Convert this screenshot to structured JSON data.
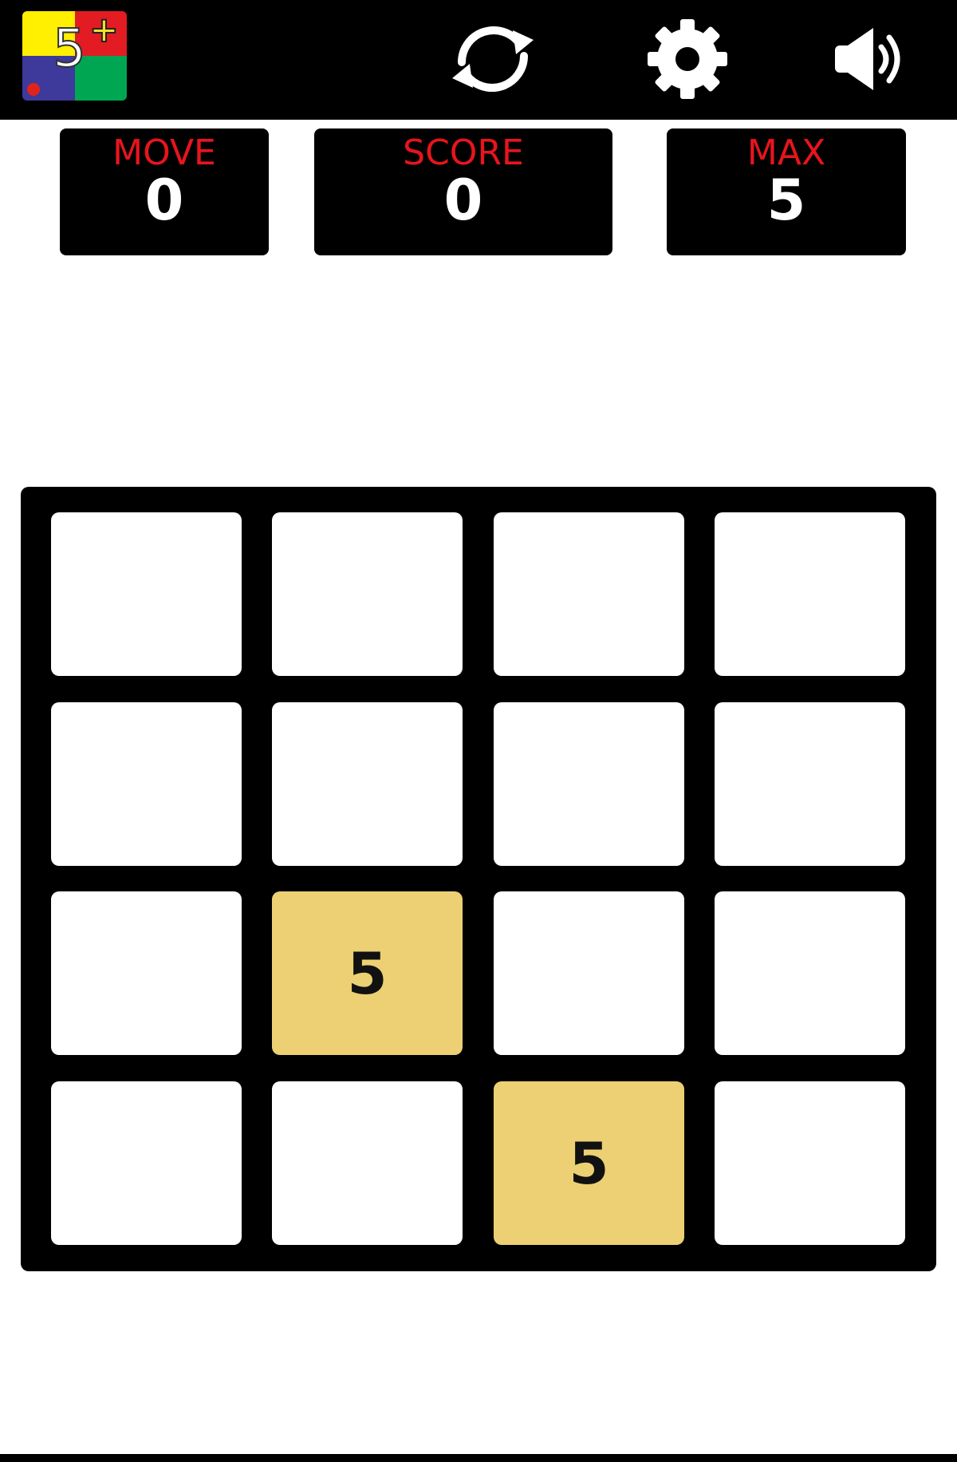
{
  "header": {
    "logo": {
      "digit": "5",
      "plus": "+",
      "colors": [
        "#ffef00",
        "#e21c22",
        "#3d3a9b",
        "#00a652"
      ]
    },
    "buttons": [
      {
        "name": "restart-icon"
      },
      {
        "name": "gear-icon"
      },
      {
        "name": "speaker-icon"
      }
    ]
  },
  "stats": {
    "move": {
      "label": "MOVE",
      "value": "0"
    },
    "score": {
      "label": "SCORE",
      "value": "0"
    },
    "max": {
      "label": "MAX",
      "value": "5"
    }
  },
  "board": {
    "rows": 4,
    "cols": 4,
    "cells": [
      "",
      "",
      "",
      "",
      "",
      "",
      "",
      "",
      "",
      "5",
      "",
      "",
      "",
      "",
      "5",
      ""
    ],
    "empty_color": "#ffffff",
    "tile_color": "#ecd073",
    "frame_color": "#000000"
  }
}
